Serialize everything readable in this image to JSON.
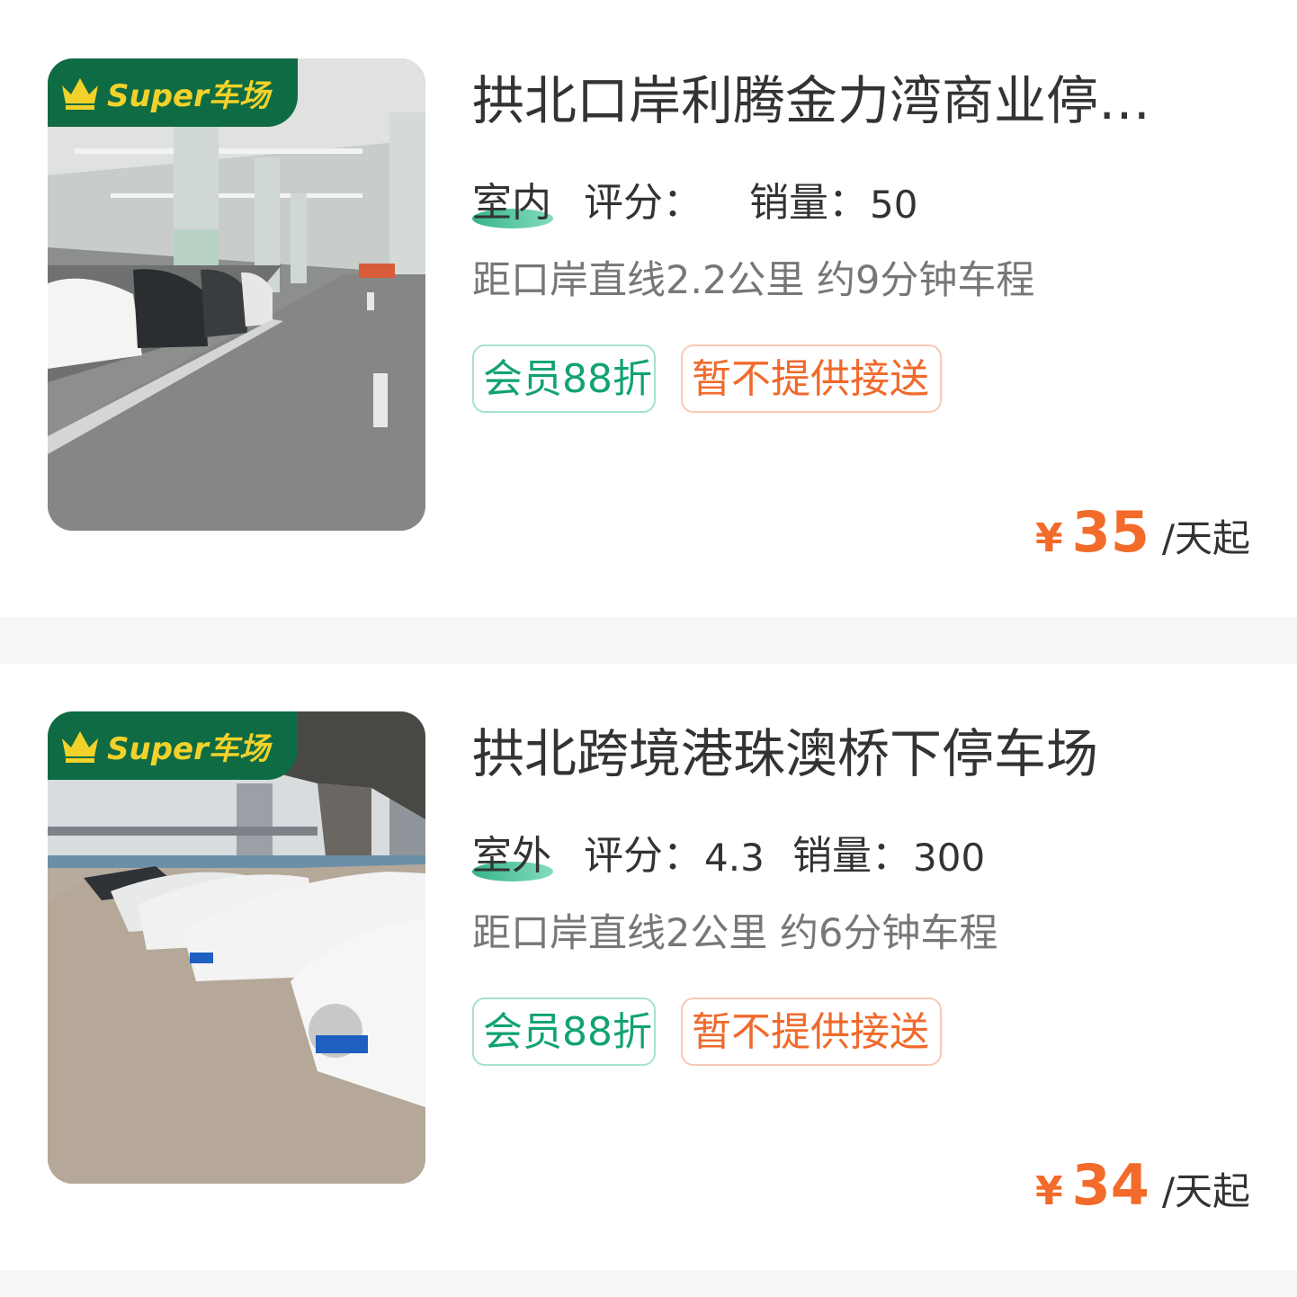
{
  "listings": [
    {
      "badge": "Super车场",
      "title": "拱北口岸利腾金力湾商业停车场",
      "type": "室内",
      "rating_label": "评分：",
      "rating": "",
      "sales_label": "销量：",
      "sales": "50",
      "distance": "距口岸直线2.2公里 约9分钟车程",
      "tags": [
        "会员88折",
        "暂不提供接送"
      ],
      "currency": "¥",
      "price": "35",
      "unit": "/天起"
    },
    {
      "badge": "Super车场",
      "title": "拱北跨境港珠澳桥下停车场",
      "type": "室外",
      "rating_label": "评分：",
      "rating": "4.3",
      "sales_label": "销量：",
      "sales": "300",
      "distance": "距口岸直线2公里 约6分钟车程",
      "tags": [
        "会员88折",
        "暂不提供接送"
      ],
      "currency": "¥",
      "price": "34",
      "unit": "/天起"
    }
  ],
  "colors": {
    "accent_green": "#12a36f",
    "badge_green": "#0f6b43",
    "badge_text": "#f2d22a",
    "price_orange": "#f26b2a",
    "divider": "#f6f6f6"
  }
}
